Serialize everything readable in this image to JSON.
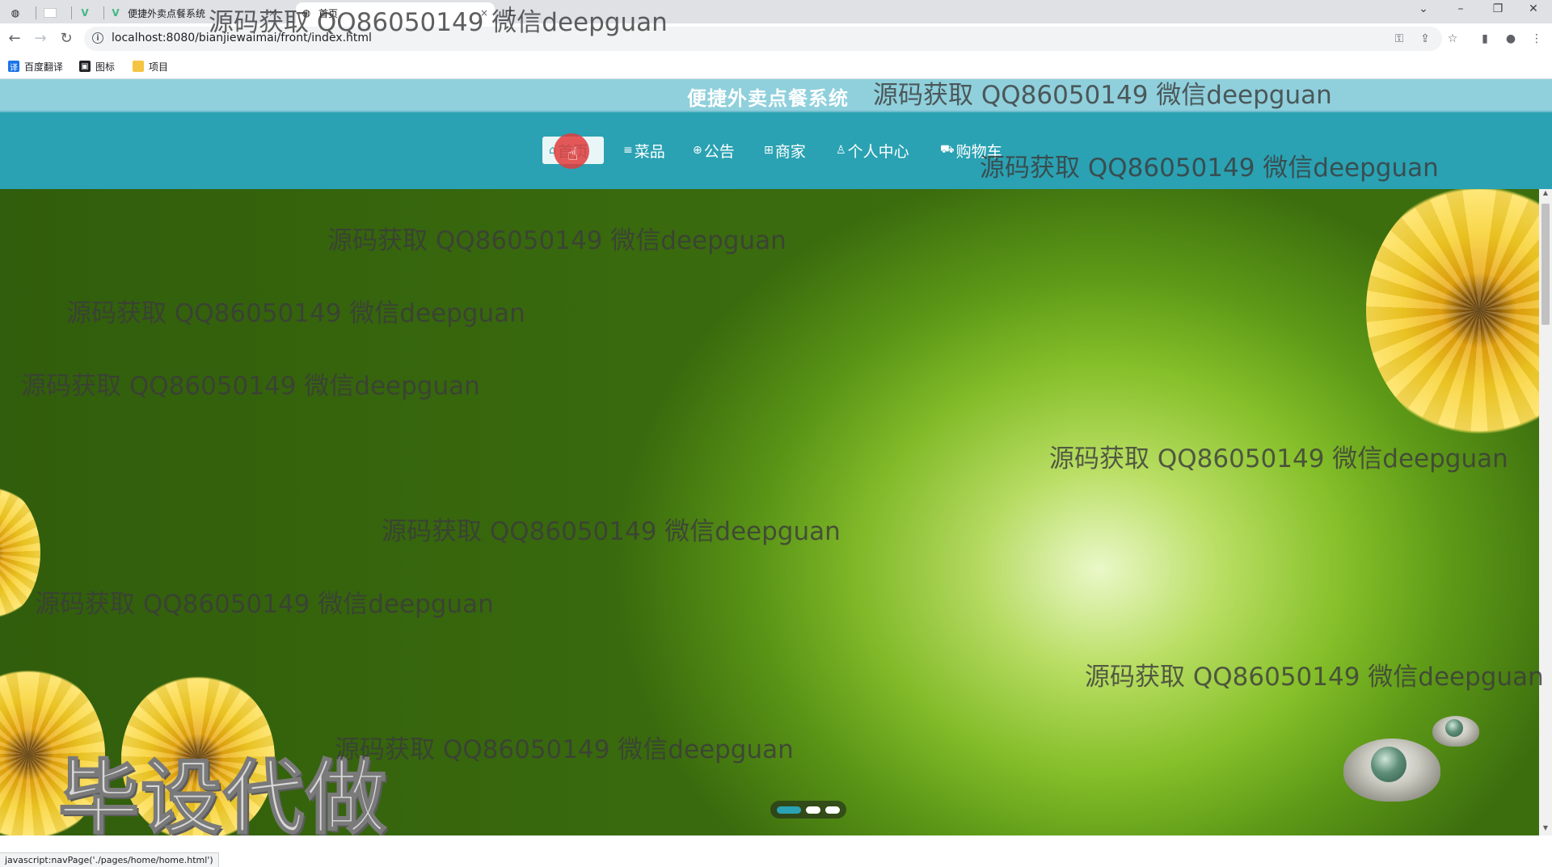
{
  "browser": {
    "tabs": [
      {
        "title": "",
        "icon": "globe-icon"
      },
      {
        "title": "",
        "icon": "blank-tab-icon"
      },
      {
        "title": "",
        "icon": "vue-icon"
      },
      {
        "title": "便捷外卖点餐系统",
        "icon": "vue-icon",
        "close": "×"
      },
      {
        "title": "首页",
        "icon": "globe-icon",
        "close": "×"
      }
    ],
    "new_tab": "+",
    "url": "localhost:8080/bianjiewaimai/front/index.html",
    "bookmarks": [
      {
        "label": "百度翻译",
        "icon": "translate-icon",
        "color": "#1a73e8"
      },
      {
        "label": "图标",
        "icon": "image-icon",
        "color": "#202124"
      },
      {
        "label": "项目",
        "icon": "folder-icon",
        "color": "#f4c542"
      }
    ],
    "status_url": "javascript:navPage('./pages/home/home.html')"
  },
  "site": {
    "title": "便捷外卖点餐系统",
    "nav": [
      {
        "label": "首页",
        "icon": "home-icon",
        "glyph": "⌂",
        "active": true
      },
      {
        "label": "菜品",
        "icon": "menu-icon",
        "glyph": "≡",
        "active": false
      },
      {
        "label": "公告",
        "icon": "globe-icon",
        "glyph": "⊕",
        "active": false
      },
      {
        "label": "商家",
        "icon": "shop-icon",
        "glyph": "⊞",
        "active": false
      },
      {
        "label": "个人中心",
        "icon": "user-icon",
        "glyph": "♙",
        "active": false
      },
      {
        "label": "购物车",
        "icon": "cart-icon",
        "glyph": "⛟",
        "active": false
      }
    ],
    "accent_color": "#2aa2b3",
    "header_color": "#8fd0dc"
  },
  "banner": {
    "text": "毕设代做",
    "slides": 3,
    "active_slide": 1
  },
  "watermark": {
    "text": "源码获取 QQ86050149 微信deepguan"
  }
}
